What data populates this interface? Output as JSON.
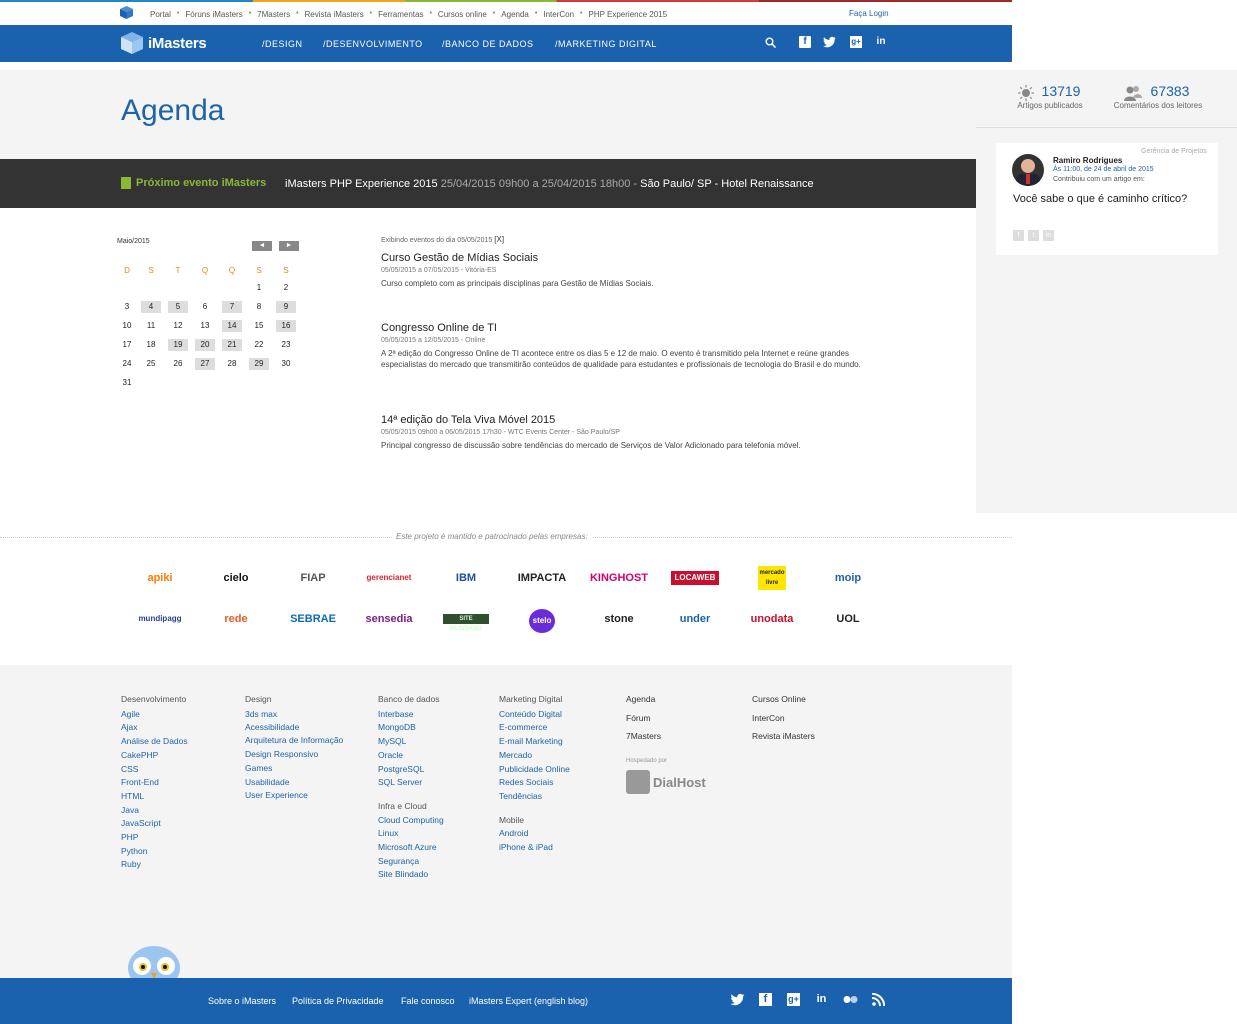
{
  "top_links": [
    "Portal",
    "Fóruns iMasters",
    "7Masters",
    "Revista iMasters",
    "Ferramentas",
    "Cursos online",
    "Agenda",
    "InterCon",
    "PHP Experience 2015"
  ],
  "login_label": "Faça Login",
  "brand": "iMasters",
  "nav": [
    "/DESIGN",
    "/DESENVOLVIMENTO",
    "/BANCO DE DADOS",
    "/MARKETING DIGITAL"
  ],
  "page_title": "Agenda",
  "next_event": {
    "label": "Próximo evento iMasters",
    "name": "iMasters PHP Experience 2015",
    "dates": "25/04/2015 09h00 a 25/04/2015 18h00 -",
    "place": "São Paulo/ SP - Hotel Renaissance"
  },
  "stats": {
    "articles_num": "13719",
    "articles_label": "Artigos publicados",
    "comments_num": "67383",
    "comments_label": "Comentários dos leitores"
  },
  "article_card": {
    "category": "Gerência de Projetos",
    "author": "Ramiro Rodrigues",
    "date": "Às 11:00, de 24 de abril de 2015",
    "sub": "Contribuiu com um artigo em:",
    "title": "Você sabe o que é caminho crítico?"
  },
  "calendar": {
    "month": "Maio/2015",
    "prev": "◄",
    "next": "►",
    "days": [
      "D",
      "S",
      "T",
      "Q",
      "Q",
      "S",
      "S"
    ]
  },
  "events_header": "Exibindo eventos do dia 05/05/2015",
  "events_header_close": "[X]",
  "events": [
    {
      "title": "Curso Gestão de Mídias Sociais",
      "meta": "05/05/2015 a 07/05/2015 - Vitória-ES",
      "desc": "Curso completo com as principais disciplinas para Gestão de Mídias Sociais."
    },
    {
      "title": "Congresso Online de TI",
      "meta": "05/05/2015 a 12/05/2015 - Online",
      "desc": "A 2ª edição do Congresso Online de TI acontece entre os dias 5 e 12 de maio. O evento é transmitido pela Internet e reúne grandes especialistas do mercado que transmitirão conteúdos de qualidade para estudantes e profissionais de tecnologia do Brasil e do mundo."
    },
    {
      "title": "14ª edição do Tela Viva Móvel 2015",
      "meta": "05/05/2015 09h00 a 06/05/2015 17h30 - WTC Events Center - São Paulo/SP",
      "desc": "Principal congresso de discussão sobre tendências do mercado de Serviços de Valor Adicionado para telefonia móvel."
    }
  ],
  "sponsors_text": "Este projeto é mantido e patrocinado pelas empresas:",
  "sponsors_row1": [
    "apiki",
    "cielo",
    "FIAP",
    "gerencianet",
    "IBM",
    "IMPACTA",
    "KINGHOST",
    "LOCAWEB",
    "mercado livre",
    "moip"
  ],
  "sponsors_row2": [
    "mundipagg",
    "rede",
    "SEBRAE",
    "sensedia",
    "SITE BLINDADO",
    "stelo",
    "stone",
    "under",
    "unodata",
    "UOL"
  ],
  "footer": {
    "dev": {
      "h": "Desenvolvimento",
      "items": [
        "Agile",
        "Ajax",
        "Análise de Dados",
        "CakePHP",
        "CSS",
        "Front-End",
        "HTML",
        "Java",
        "JavaScript",
        "PHP",
        "Python",
        "Ruby"
      ]
    },
    "design": {
      "h": "Design",
      "items": [
        "3ds max",
        "Acessibilidade",
        "Arquitetura de Informação",
        "Design Responsivo",
        "Games",
        "Usabilidade",
        "User Experience"
      ]
    },
    "db": {
      "h": "Banco de dados",
      "items": [
        "Interbase",
        "MongoDB",
        "MySQL",
        "Oracle",
        "PostgreSQL",
        "SQL Server"
      ],
      "h2": "Infra e Cloud",
      "items2": [
        "Cloud Computing",
        "Linux",
        "Microsoft Azure",
        "Segurança",
        "Site Blindado"
      ]
    },
    "mkt": {
      "h": "Marketing Digital",
      "items": [
        "Conteúdo Digital",
        "E-commerce",
        "E-mail Marketing",
        "Mercado",
        "Publicidade Online",
        "Redes Sociais",
        "Tendências"
      ],
      "h2": "Mobile",
      "items2": [
        "Android",
        "iPhone & iPad"
      ]
    },
    "misc": {
      "items": [
        "Agenda",
        "Fórum",
        "7Masters"
      ],
      "hosted_label": "Hospedado por",
      "hosted_brand": "DialHost"
    },
    "misc2": {
      "items": [
        "Cursos Online",
        "InterCon",
        "Revista iMasters"
      ]
    }
  },
  "bottom_links": [
    "Sobre o iMasters",
    "Política de Privacidade",
    "Fale conosco",
    "iMasters Expert (english blog)"
  ]
}
